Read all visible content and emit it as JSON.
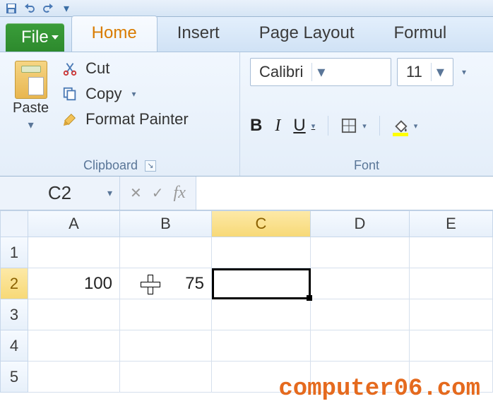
{
  "window": {
    "qat": [
      "save-icon",
      "undo-icon",
      "redo-icon",
      "customize-icon"
    ]
  },
  "tabs": {
    "file": "File",
    "items": [
      {
        "label": "Home",
        "active": true
      },
      {
        "label": "Insert",
        "active": false
      },
      {
        "label": "Page Layout",
        "active": false
      },
      {
        "label": "Formul",
        "active": false
      }
    ]
  },
  "ribbon": {
    "clipboard": {
      "title": "Clipboard",
      "paste": "Paste",
      "cut": "Cut",
      "copy": "Copy",
      "format_painter": "Format Painter"
    },
    "font": {
      "title": "Font",
      "name": "Calibri",
      "size": "11"
    }
  },
  "namebox": "C2",
  "formula": "",
  "columns": [
    "A",
    "B",
    "C",
    "D",
    "E"
  ],
  "selected_column": "C",
  "rows": [
    "1",
    "2",
    "3",
    "4",
    "5"
  ],
  "selected_row": "2",
  "cells": {
    "A2": "100",
    "B2": "75"
  },
  "watermark": "computer06.com"
}
